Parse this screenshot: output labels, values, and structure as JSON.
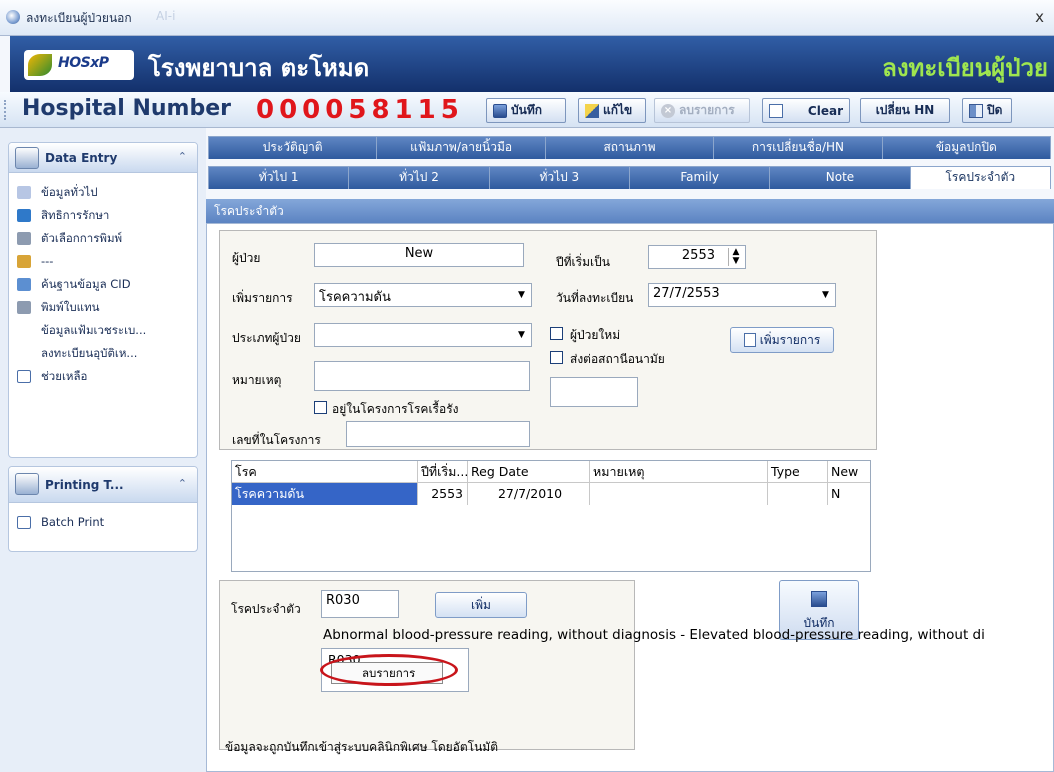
{
  "window": {
    "title": "ลงทะเบียนผู้ป่วยนอก",
    "title_faded": "AI-i"
  },
  "banner": {
    "logo_text": "HOSxP",
    "hospital_name": "โรงพยาบาล ตะโหมด",
    "page_heading": "ลงทะเบียนผู้ป่วย"
  },
  "toolbar": {
    "hn_label": "Hospital Number",
    "hn_value": "000058115",
    "save_label": "บันทึก",
    "edit_label": "แก้ไข",
    "delete_label": "ลบรายการ",
    "clear_label": "Clear",
    "change_hn_label": "เปลี่ยน HN",
    "close_label": "ปิด"
  },
  "sidebar": {
    "data_entry": {
      "title": "Data Entry",
      "items": [
        {
          "label": "ข้อมูลทั่วไป",
          "icon": "user-icon"
        },
        {
          "label": "สิทธิการรักษา",
          "icon": "shield-icon"
        },
        {
          "label": "ตัวเลือกการพิมพ์",
          "icon": "printer-icon"
        },
        {
          "label": "---",
          "icon": "users-icon"
        },
        {
          "label": "ค้นฐานข้อมูล CID",
          "icon": "search-db-icon"
        },
        {
          "label": "พิมพ์ใบแทน",
          "icon": "printer-icon"
        },
        {
          "label": "ข้อมูลแฟ้มเวชระเบ...",
          "icon": ""
        },
        {
          "label": "ลงทะเบียนอุบัติเห...",
          "icon": ""
        },
        {
          "label": "ช่วยเหลือ",
          "icon": "help-icon"
        }
      ]
    },
    "printing": {
      "title": "Printing T...",
      "items": [
        {
          "label": "Batch Print",
          "icon": "batch-print-icon"
        }
      ]
    }
  },
  "tabs_row1": [
    "ประวัติญาติ",
    "แฟ้มภาพ/ลายนิ้วมือ",
    "สถานภาพ",
    "การเปลี่ยนชื่อ/HN",
    "ข้อมูลปกปิด"
  ],
  "tabs_row2": [
    "ทั่วไป 1",
    "ทั่วไป 2",
    "ทั่วไป 3",
    "Family",
    "Note",
    "โรคประจำตัว"
  ],
  "section_title": "โรคประจำตัว",
  "form": {
    "patient_label": "ผู้ป่วย",
    "patient_value": "New",
    "start_year_label": "ปีที่เริ่มเป็น",
    "start_year_value": "2553",
    "add_item_label": "เพิ่มรายการ",
    "add_item_value": "โรคความดัน",
    "reg_date_label": "วันที่ลงทะเบียน",
    "reg_date_value": "27/7/2553",
    "patient_type_label": "ประเภทผู้ป่วย",
    "patient_type_value": "",
    "new_patient_label": "ผู้ป่วยใหม่",
    "refer_label": "ส่งต่อสถานีอนามัย",
    "add_button_label": "เพิ่มรายการ",
    "note_label": "หมายเหตุ",
    "note_value": "",
    "chronic_program_label": "อยู่ในโครงการโรคเรื้อรัง",
    "program_number_label": "เลขที่ในโครงการ",
    "program_number_value": ""
  },
  "table": {
    "headers": [
      "โรค",
      "ปีที่เริ่ม...",
      "Reg Date",
      "หมายเหตุ",
      "Type",
      "New"
    ],
    "rows": [
      [
        "โรคความดัน",
        "2553",
        "27/7/2010",
        "",
        "",
        "N"
      ]
    ]
  },
  "diag": {
    "label": "โรคประจำตัว",
    "code_value": "R030",
    "add_button": "เพิ่ม",
    "description": "Abnormal blood-pressure reading, without diagnosis - Elevated blood-pressure reading, without di",
    "list_item": "R030",
    "context_item": "ลบรายการ",
    "save_label": "บันทึก",
    "autosave_note": "ข้อมูลจะถูกบันทึกเข้าสู่ระบบคลินิกพิเศษ โดยอัตโนมัติ"
  }
}
